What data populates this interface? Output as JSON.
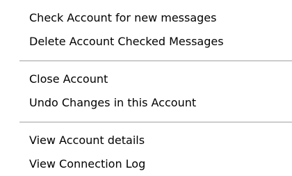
{
  "menu": {
    "groups": [
      {
        "items": [
          {
            "label": "Check Account for new messages"
          },
          {
            "label": "Delete Account Checked Messages"
          }
        ]
      },
      {
        "items": [
          {
            "label": "Close Account"
          },
          {
            "label": "Undo Changes in this Account"
          }
        ]
      },
      {
        "items": [
          {
            "label": "View Account details"
          },
          {
            "label": "View Connection Log"
          }
        ]
      }
    ]
  },
  "colors": {
    "background": "#ffffff",
    "text": "#000000",
    "separator": "#a0a0a0"
  }
}
